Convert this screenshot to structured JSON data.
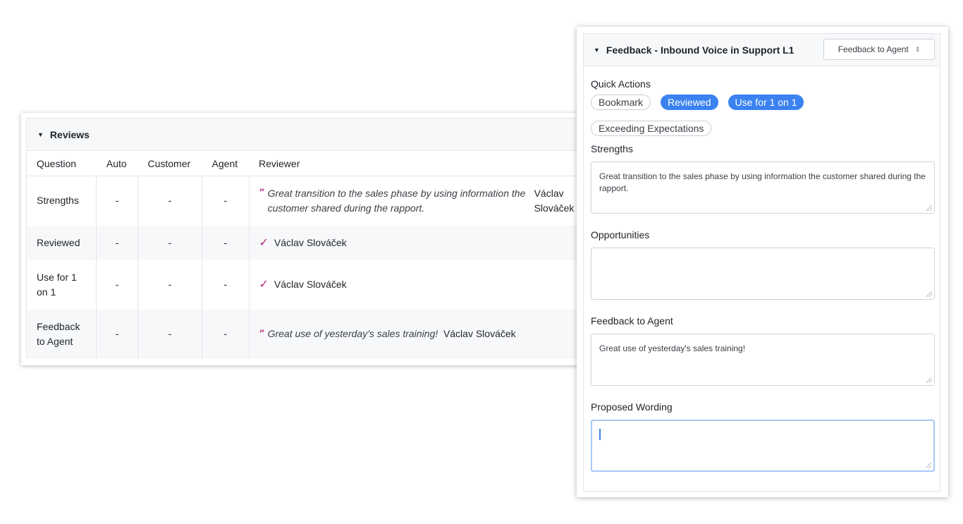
{
  "reviews": {
    "title": "Reviews",
    "columns": [
      "Question",
      "Auto",
      "Customer",
      "Agent",
      "Reviewer"
    ],
    "rows": [
      {
        "question": "Strengths",
        "auto": "-",
        "customer": "-",
        "agent": "-",
        "reviewer_quote": "Great transition to the sales phase by using information the customer shared during the rapport.",
        "reviewer_name": "Václav Slováček"
      },
      {
        "question": "Reviewed",
        "auto": "-",
        "customer": "-",
        "agent": "-",
        "reviewer_name": "Václav Slováček"
      },
      {
        "question": "Use for 1 on 1",
        "auto": "-",
        "customer": "-",
        "agent": "-",
        "reviewer_name": "Václav Slováček"
      },
      {
        "question": "Feedback to Agent",
        "auto": "-",
        "customer": "-",
        "agent": "-",
        "reviewer_quote": "Great use of yesterday's sales training!",
        "reviewer_name": "Václav Slováček"
      }
    ]
  },
  "feedback": {
    "title": "Feedback - Inbound Voice in Support L1",
    "select_value": "Feedback to Agent",
    "quick_actions_label": "Quick Actions",
    "quick_actions": {
      "bookmark": "Bookmark",
      "reviewed": "Reviewed",
      "use_for_1on1": "Use for 1 on 1",
      "exceeding": "Exceeding Expectations"
    },
    "strengths_label": "Strengths",
    "strengths_value": "Great transition to the sales phase by using information the customer shared during the rapport.",
    "opportunities_label": "Opportunities",
    "opportunities_value": "",
    "feedback_to_agent_label": "Feedback to Agent",
    "feedback_to_agent_value": "Great use of yesterday's sales training!",
    "proposed_wording_label": "Proposed Wording",
    "proposed_wording_value": ""
  },
  "colors": {
    "accent": "#3b82f0",
    "quote": "#b0277f",
    "header_bg": "#f7f8f9",
    "border": "#e3e6ea"
  }
}
